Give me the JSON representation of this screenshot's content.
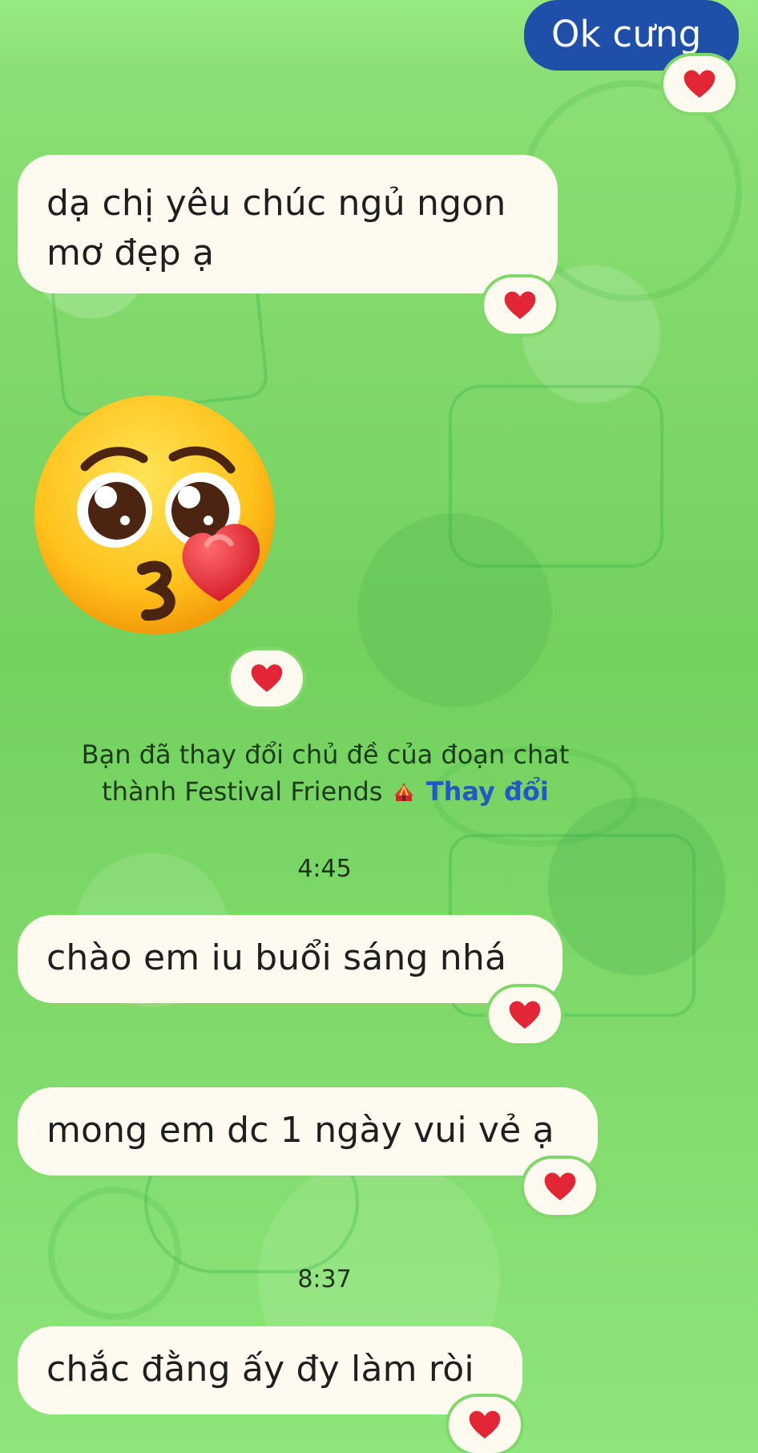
{
  "messages": {
    "ok": "Ok cưng",
    "goodnight": "dạ chị yêu chúc ngủ ngon\nmơ đẹp ạ",
    "morning": "chào em iu buổi sáng nhá",
    "wish": "mong em dc 1 ngày vui vẻ ạ",
    "last": "chắc đằng ấy đy làm ròi"
  },
  "system": {
    "line1": "Bạn đã thay đổi chủ đề của đoạn chat",
    "line2_prefix": "thành Festival Friends",
    "link": "Thay đổi"
  },
  "times": {
    "first": "4:45",
    "second": "8:37"
  },
  "icons": {
    "reaction": "heart-icon",
    "sticker": "kissing-face-with-heart-icon",
    "theme": "circus-tent-icon"
  },
  "colors": {
    "background": "#7fd86a",
    "incoming_bubble": "#fffaf0",
    "outgoing_bubble": "#1f4fa8",
    "link": "#2358c7",
    "heart": "#e32636"
  }
}
